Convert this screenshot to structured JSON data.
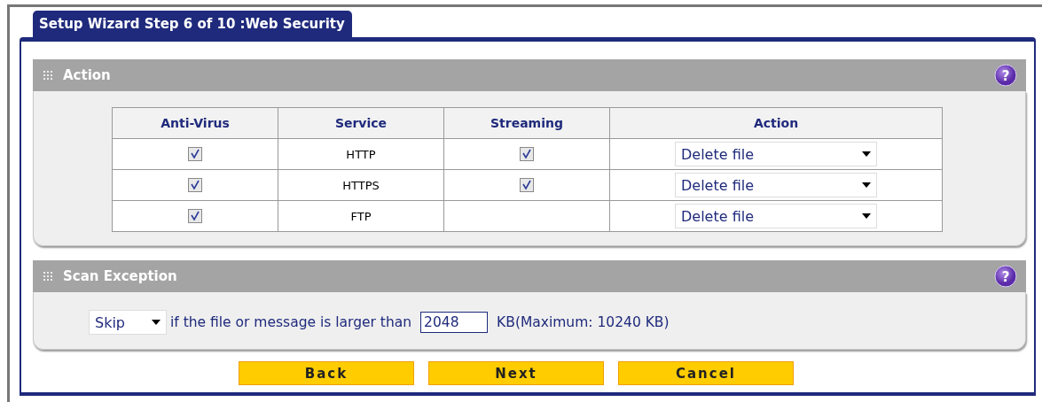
{
  "tab": {
    "title": "Setup Wizard Step 6 of 10 :Web Security"
  },
  "action_section": {
    "title": "Action",
    "help": "?",
    "columns": [
      "Anti-Virus",
      "Service",
      "Streaming",
      "Action"
    ],
    "rows": [
      {
        "anti_virus": {
          "checked": true
        },
        "service": "HTTP",
        "streaming": {
          "checked": true
        },
        "action": "Delete file"
      },
      {
        "anti_virus": {
          "checked": true
        },
        "service": "HTTPS",
        "streaming": {
          "checked": true
        },
        "action": "Delete file"
      },
      {
        "anti_virus": {
          "checked": true
        },
        "service": "FTP",
        "action": "Delete file"
      }
    ]
  },
  "scan_exception": {
    "title": "Scan Exception",
    "help": "?",
    "mode": "Skip",
    "text": "if the file or message is larger than",
    "size": "2048",
    "limit": "KB(Maximum: 10240 KB)"
  },
  "buttons": [
    "Back",
    "Next",
    "Cancel"
  ]
}
